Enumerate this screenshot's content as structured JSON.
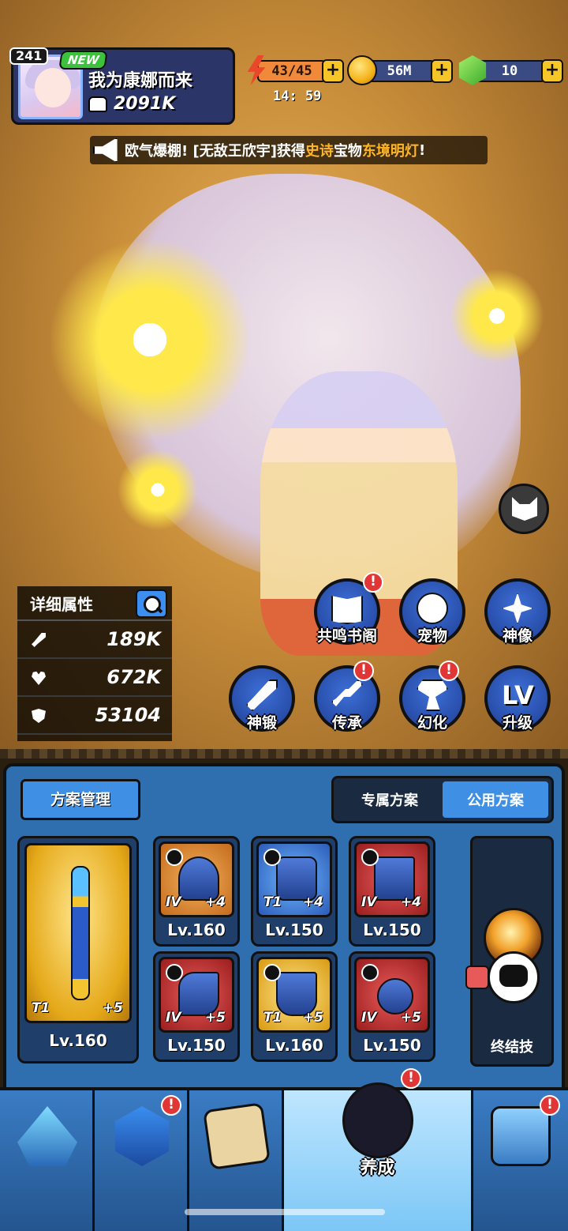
{
  "player": {
    "level": "241",
    "new_badge": "NEW",
    "name": "我为康娜而来",
    "power": "2091K"
  },
  "resources": {
    "energy": "43/45",
    "coins": "56M",
    "gems": "10",
    "plus": "+",
    "timer": "14: 59"
  },
  "broadcast": {
    "prefix": "欧气爆棚! [无敌王欣宇]获得",
    "rarity": "史诗",
    "mid": "宝物",
    "item": "东境明灯",
    "suffix": "!"
  },
  "stats": {
    "title": "详细属性",
    "attack": "189K",
    "hp": "672K",
    "defense": "53104"
  },
  "features": {
    "resonance": "共鸣书阁",
    "pet": "宠物",
    "statue": "神像",
    "forge": "神锻",
    "inherit": "传承",
    "illusion": "幻化",
    "levelup": "升级",
    "lv_glyph": "LV",
    "alert": "!"
  },
  "equip": {
    "plan_manage": "方案管理",
    "tab_exclusive": "专属方案",
    "tab_public": "公用方案",
    "finisher": "终结技",
    "main": {
      "tier": "T1",
      "plus": "+5",
      "level": "Lv.160"
    },
    "items": [
      {
        "tier": "IV",
        "plus": "+4",
        "level": "Lv.160"
      },
      {
        "tier": "T1",
        "plus": "+4",
        "level": "Lv.150"
      },
      {
        "tier": "IV",
        "plus": "+4",
        "level": "Lv.150"
      },
      {
        "tier": "IV",
        "plus": "+5",
        "level": "Lv.150"
      },
      {
        "tier": "T1",
        "plus": "+5",
        "level": "Lv.160"
      },
      {
        "tier": "IV",
        "plus": "+5",
        "level": "Lv.150"
      }
    ]
  },
  "nav": {
    "active_label": "养成"
  }
}
